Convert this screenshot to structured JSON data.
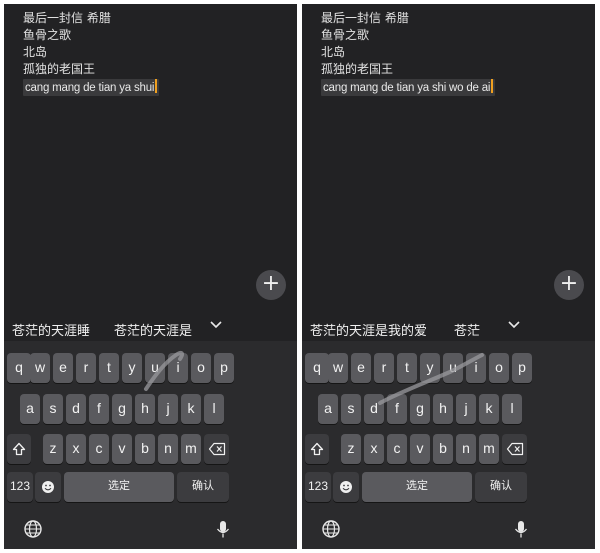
{
  "panels": [
    {
      "id": "left",
      "notes": [
        "最后一封信 希腊",
        "鱼骨之歌",
        "北岛",
        "孤独的老国王"
      ],
      "input_text": "cang mang de tian ya shui",
      "candidates": [
        "苍茫的天涯睡",
        "苍茫的天涯是"
      ],
      "keys": {
        "row1": [
          "q",
          "w",
          "e",
          "r",
          "t",
          "y",
          "u",
          "i",
          "o",
          "p"
        ],
        "row2": [
          "a",
          "s",
          "d",
          "f",
          "g",
          "h",
          "j",
          "k",
          "l"
        ],
        "row3": [
          "z",
          "x",
          "c",
          "v",
          "b",
          "n",
          "m"
        ],
        "num_label": "123",
        "space_label": "选定",
        "enter_label": "确认"
      }
    },
    {
      "id": "right",
      "notes": [
        "最后一封信 希腊",
        "鱼骨之歌",
        "北岛",
        "孤独的老国王"
      ],
      "input_text": "cang mang de tian ya shi wo de ai",
      "candidates": [
        "苍茫的天涯是我的爱",
        "苍茫"
      ],
      "keys": {
        "row1": [
          "q",
          "w",
          "e",
          "r",
          "t",
          "y",
          "u",
          "i",
          "o",
          "p"
        ],
        "row2": [
          "a",
          "s",
          "d",
          "f",
          "g",
          "h",
          "j",
          "k",
          "l"
        ],
        "row3": [
          "z",
          "x",
          "c",
          "v",
          "b",
          "n",
          "m"
        ],
        "num_label": "123",
        "space_label": "选定",
        "enter_label": "确认"
      }
    }
  ],
  "icons": {
    "fab": "plus-icon",
    "expand": "chevron-down-icon",
    "shift": "shift-icon",
    "backspace": "backspace-icon",
    "emoji": "emoji-icon",
    "globe": "globe-icon",
    "mic": "microphone-icon"
  },
  "colors": {
    "background": "#222224",
    "keyboard": "#2b2b2d",
    "key": "#5a5a5e",
    "func_key": "#3c3c3f",
    "caret": "#f0a020",
    "text": "#e2e2e2"
  }
}
